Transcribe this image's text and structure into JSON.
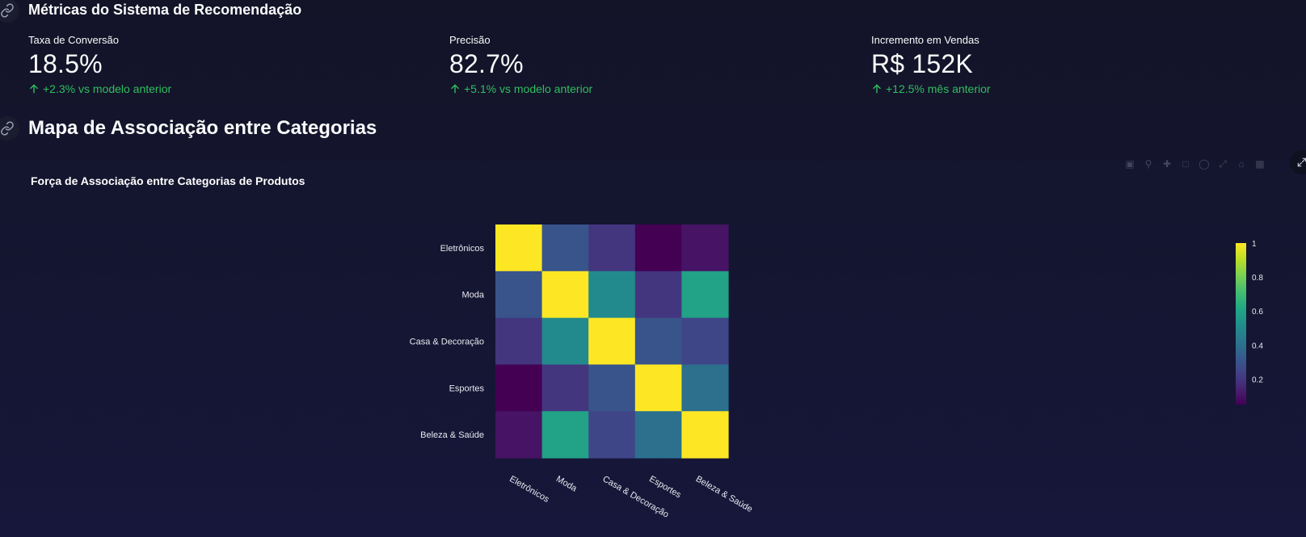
{
  "metrics_section": {
    "title": "Métricas do Sistema de Recomendação",
    "metrics": [
      {
        "label": "Taxa de Conversão",
        "value": "18.5%",
        "delta": "+2.3% vs modelo anterior"
      },
      {
        "label": "Precisão",
        "value": "82.7%",
        "delta": "+5.1% vs modelo anterior"
      },
      {
        "label": "Incremento em Vendas",
        "value": "R$ 152K",
        "delta": "+12.5% mês anterior"
      }
    ]
  },
  "map_section": {
    "title": "Mapa de Associação entre Categorias"
  },
  "colors": {
    "delta_positive": "#2fbf5e",
    "background": "#141530"
  },
  "icons": {
    "anchor": "link-icon",
    "delta": "arrow-up-icon",
    "fullscreen": "expand-icon"
  },
  "chart_data": {
    "type": "heatmap",
    "title": "Força de Associação entre Categorias de Produtos",
    "x": [
      "Eletrônicos",
      "Moda",
      "Casa & Decoração",
      "Esportes",
      "Beleza & Saúde"
    ],
    "y": [
      "Eletrônicos",
      "Moda",
      "Casa & Decoração",
      "Esportes",
      "Beleza & Saúde"
    ],
    "z": [
      [
        1.0,
        0.3,
        0.2,
        0.05,
        0.1
      ],
      [
        0.3,
        1.0,
        0.5,
        0.2,
        0.6
      ],
      [
        0.2,
        0.5,
        1.0,
        0.3,
        0.25
      ],
      [
        0.05,
        0.2,
        0.3,
        1.0,
        0.4
      ],
      [
        0.1,
        0.6,
        0.25,
        0.4,
        1.0
      ]
    ],
    "colorscale": "Viridis",
    "zmin": 0.05,
    "zmax": 1.0,
    "colorbar_ticks": [
      0.2,
      0.4,
      0.6,
      0.8,
      1
    ],
    "colorbar_tick_labels": [
      "0.2",
      "0.4",
      "0.6",
      "0.8",
      "1"
    ]
  }
}
